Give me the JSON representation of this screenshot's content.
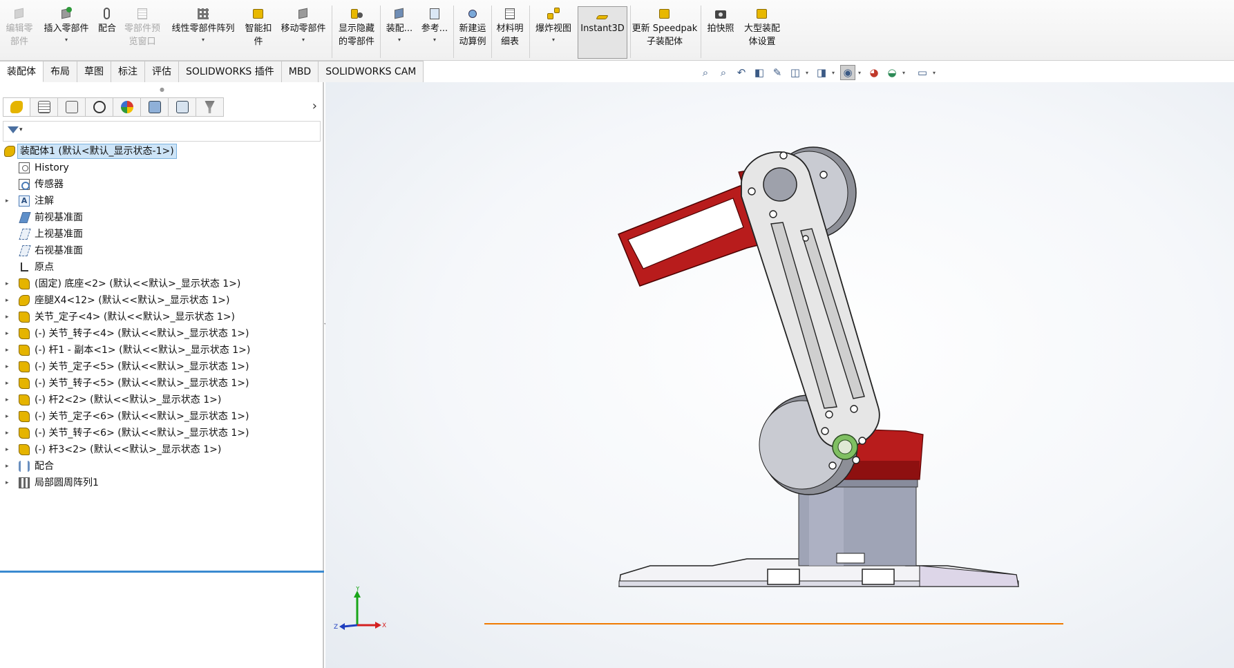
{
  "ribbon": {
    "items": [
      {
        "label_line1": "编辑零",
        "label_line2": "部件",
        "disabled": true
      },
      {
        "label_line1": "插入零部件",
        "label_line2": "",
        "dropdown": true
      },
      {
        "label_line1": "配合",
        "label_line2": ""
      },
      {
        "label_line1": "零部件预",
        "label_line2": "览窗口",
        "disabled": true
      },
      {
        "label_line1": "线性零部件阵列",
        "label_line2": "",
        "dropdown": true
      },
      {
        "label_line1": "智能扣",
        "label_line2": "件"
      },
      {
        "label_line1": "移动零部件",
        "label_line2": "",
        "dropdown": true
      },
      {
        "label_line1": "显示隐藏",
        "label_line2": "的零部件"
      },
      {
        "label_line1": "装配...",
        "label_line2": "",
        "dropdown": true
      },
      {
        "label_line1": "参考...",
        "label_line2": "",
        "dropdown": true
      },
      {
        "label_line1": "新建运",
        "label_line2": "动算例"
      },
      {
        "label_line1": "材料明",
        "label_line2": "细表"
      },
      {
        "label_line1": "爆炸视图",
        "label_line2": "",
        "dropdown": true
      },
      {
        "label_line1": "Instant3D",
        "label_line2": "",
        "active": true
      },
      {
        "label_line1": "更新 Speedpak",
        "label_line2": "子装配体"
      },
      {
        "label_line1": "拍快照",
        "label_line2": ""
      },
      {
        "label_line1": "大型装配",
        "label_line2": "体设置"
      }
    ]
  },
  "command_tabs": [
    "装配体",
    "布局",
    "草图",
    "标注",
    "评估",
    "SOLIDWORKS 插件",
    "MBD",
    "SOLIDWORKS CAM"
  ],
  "active_tab": "装配体",
  "feature_tree": {
    "root": "装配体1  (默认<默认_显示状态-1>)",
    "items": [
      {
        "label": "History",
        "icon": "history-icon",
        "expandable": false
      },
      {
        "label": "传感器",
        "icon": "sensor-icon",
        "expandable": false
      },
      {
        "label": "注解",
        "icon": "annotation-icon",
        "expandable": true
      },
      {
        "label": "前视基准面",
        "icon": "plane-icon",
        "expandable": false
      },
      {
        "label": "上视基准面",
        "icon": "plane-icon",
        "expandable": false
      },
      {
        "label": "右视基准面",
        "icon": "plane-icon",
        "expandable": false
      },
      {
        "label": "原点",
        "icon": "origin-icon",
        "expandable": false
      },
      {
        "label": "(固定) 底座<2> (默认<<默认>_显示状态 1>)",
        "icon": "part-icon",
        "expandable": true
      },
      {
        "label": "座腿X4<12> (默认<<默认>_显示状态 1>)",
        "icon": "subassembly-icon",
        "expandable": true
      },
      {
        "label": "关节_定子<4> (默认<<默认>_显示状态 1>)",
        "icon": "part-icon",
        "expandable": true
      },
      {
        "label": "(-) 关节_转子<4> (默认<<默认>_显示状态 1>)",
        "icon": "part-icon",
        "expandable": true
      },
      {
        "label": "(-) 杆1 - 副本<1> (默认<<默认>_显示状态 1>)",
        "icon": "part-icon",
        "expandable": true
      },
      {
        "label": "(-) 关节_定子<5> (默认<<默认>_显示状态 1>)",
        "icon": "part-icon",
        "expandable": true
      },
      {
        "label": "(-) 关节_转子<5> (默认<<默认>_显示状态 1>)",
        "icon": "part-icon",
        "expandable": true
      },
      {
        "label": "(-) 杆2<2> (默认<<默认>_显示状态 1>)",
        "icon": "part-icon",
        "expandable": true
      },
      {
        "label": "(-) 关节_定子<6> (默认<<默认>_显示状态 1>)",
        "icon": "part-icon",
        "expandable": true
      },
      {
        "label": "(-) 关节_转子<6> (默认<<默认>_显示状态 1>)",
        "icon": "part-icon",
        "expandable": true
      },
      {
        "label": "(-) 杆3<2> (默认<<默认>_显示状态 1>)",
        "icon": "part-icon",
        "expandable": true
      },
      {
        "label": "配合",
        "icon": "mates-icon",
        "expandable": true
      },
      {
        "label": "局部圆周阵列1",
        "icon": "pattern-icon",
        "expandable": true
      }
    ]
  },
  "triad": {
    "y": "Y",
    "x": "X",
    "z": "Z"
  },
  "colors": {
    "gripper": "#b81c1c",
    "link": "#d4d4d4",
    "base": "#9aa0b3",
    "axis_line": "#f07a00",
    "accent": "#3a8ad0"
  }
}
